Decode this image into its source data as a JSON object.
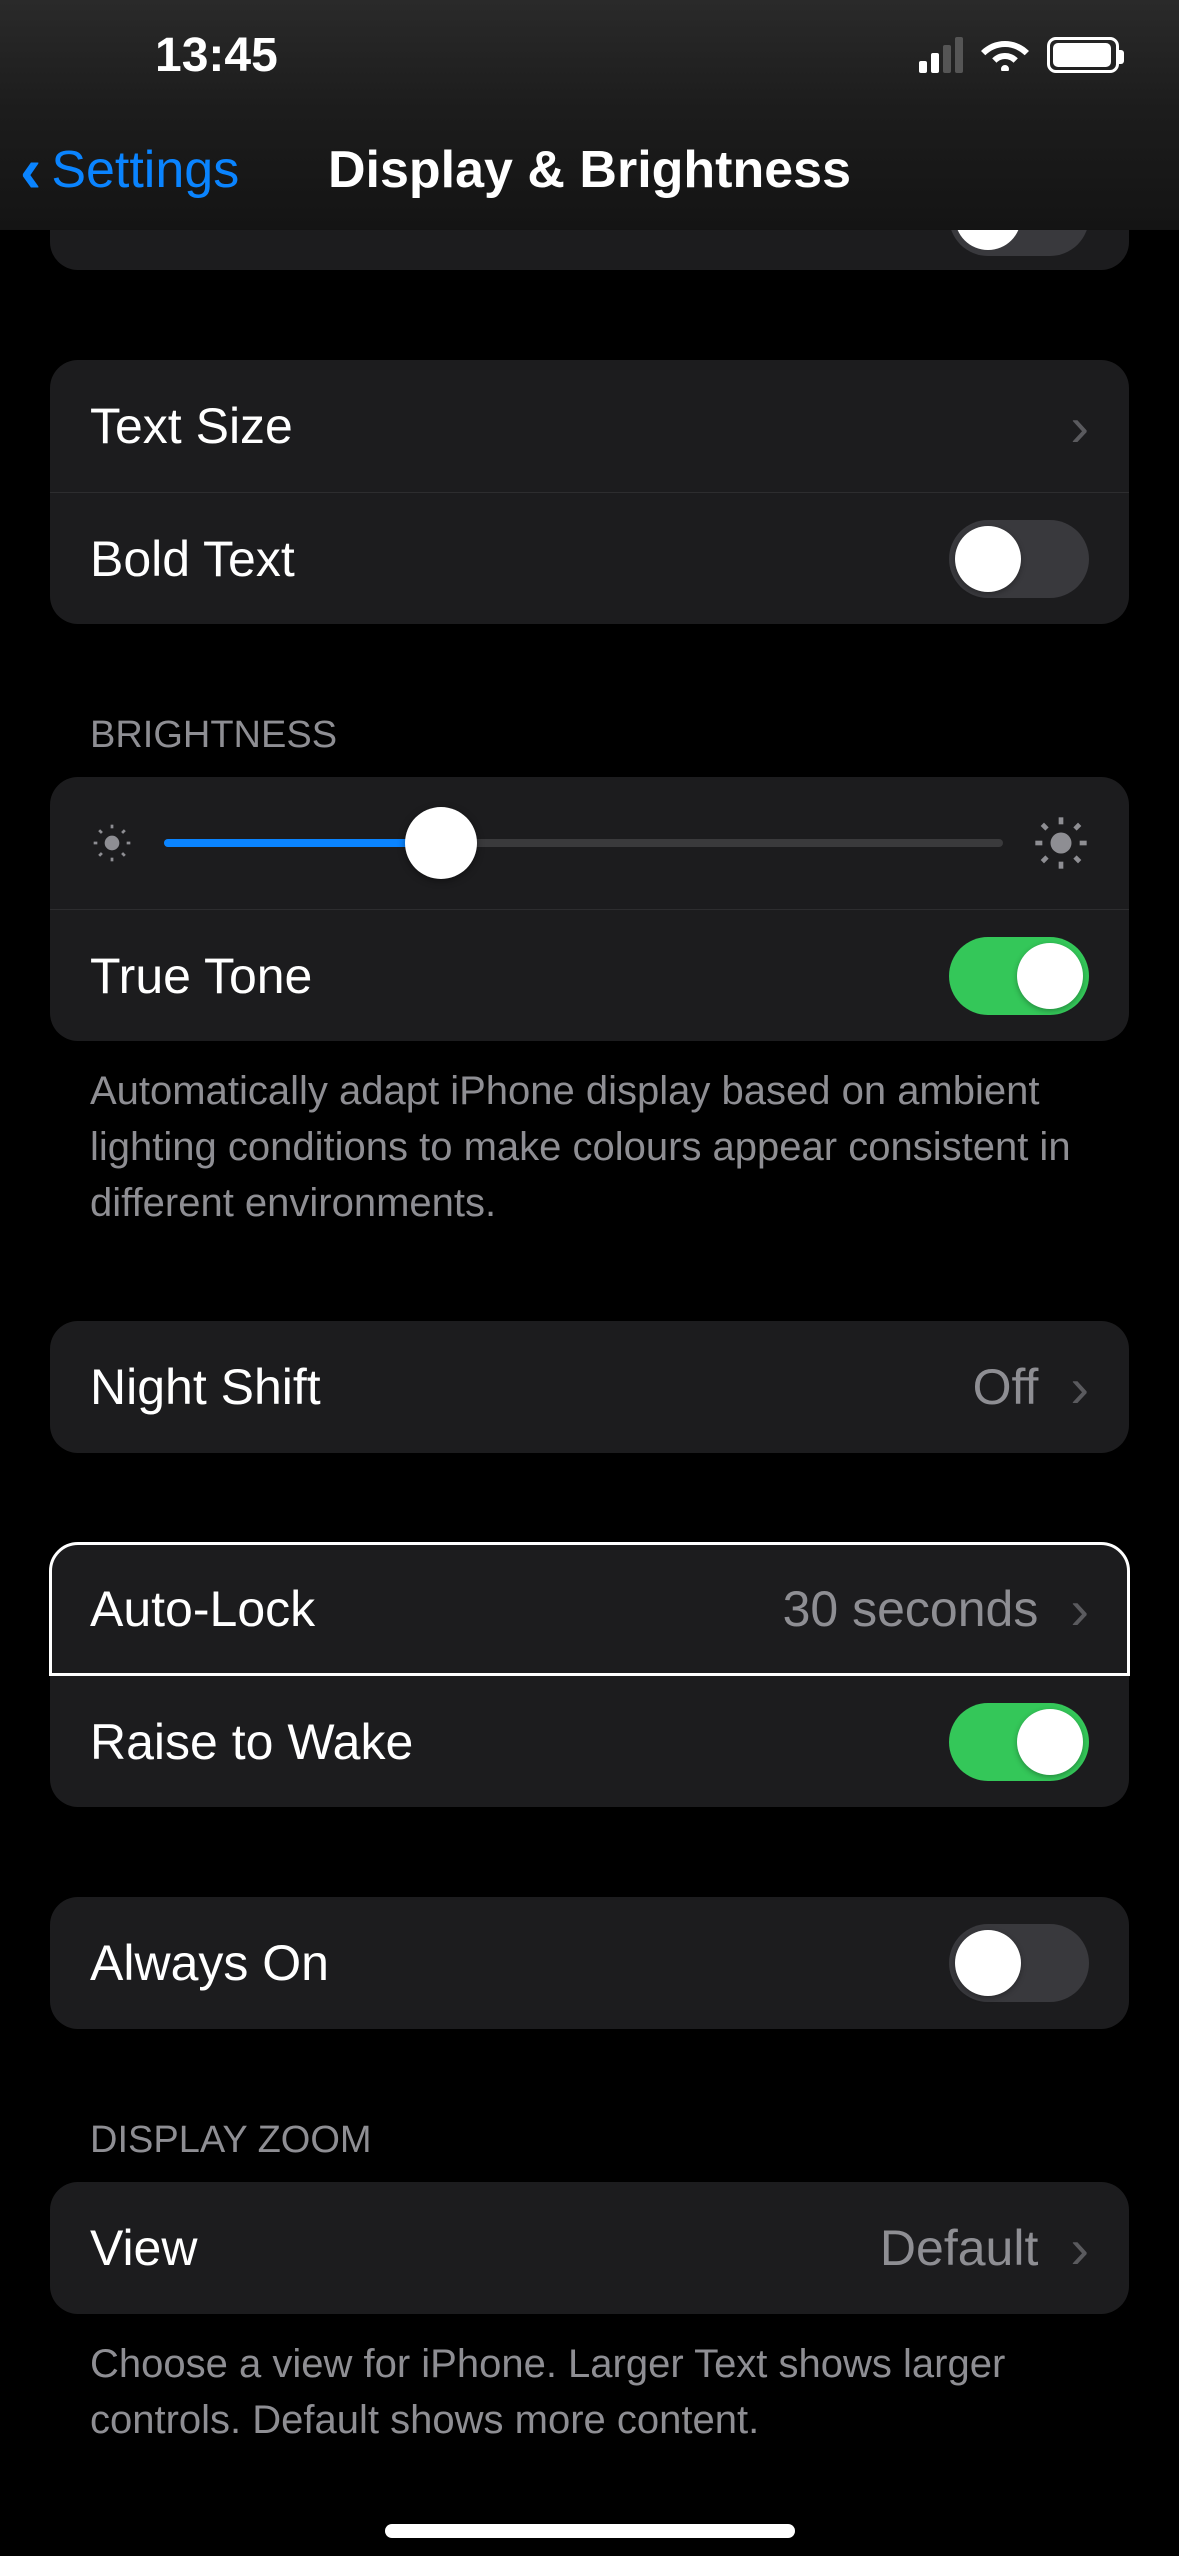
{
  "status": {
    "time": "13:45"
  },
  "nav": {
    "back_label": "Settings",
    "title": "Display & Brightness"
  },
  "rows": {
    "text_size": "Text Size",
    "bold_text": "Bold Text",
    "true_tone": "True Tone",
    "night_shift": "Night Shift",
    "night_shift_value": "Off",
    "auto_lock": "Auto-Lock",
    "auto_lock_value": "30 seconds",
    "raise_to_wake": "Raise to Wake",
    "always_on": "Always On",
    "view": "View",
    "view_value": "Default"
  },
  "sections": {
    "brightness_header": "BRIGHTNESS",
    "true_tone_footer": "Automatically adapt iPhone display based on ambient lighting conditions to make colours appear consistent in different environments.",
    "display_zoom_header": "DISPLAY ZOOM",
    "display_zoom_footer": "Choose a view for iPhone. Larger Text shows larger controls. Default shows more content."
  },
  "brightness": {
    "percent": 33
  }
}
